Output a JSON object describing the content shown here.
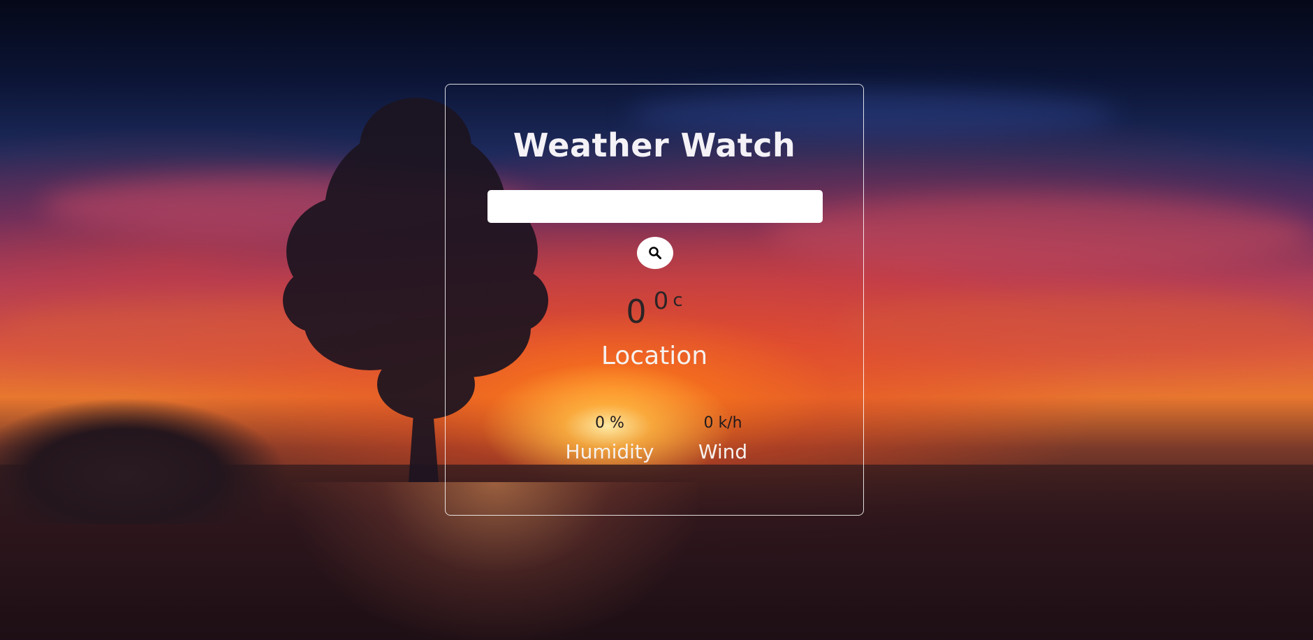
{
  "app": {
    "title": "Weather Watch"
  },
  "search": {
    "value": "",
    "placeholder": "",
    "button_icon": "search-icon"
  },
  "weather": {
    "temperature": "0",
    "degree_symbol": "0",
    "unit": "c",
    "location": "Location",
    "humidity_value": "0 %",
    "humidity_label": "Humidity",
    "wind_value": "0 k/h",
    "wind_label": "Wind"
  },
  "colors": {
    "card_border": "#ffffff",
    "title_text": "#f4f2f6",
    "dark_text": "#2b2426",
    "input_bg": "#ffffff"
  }
}
